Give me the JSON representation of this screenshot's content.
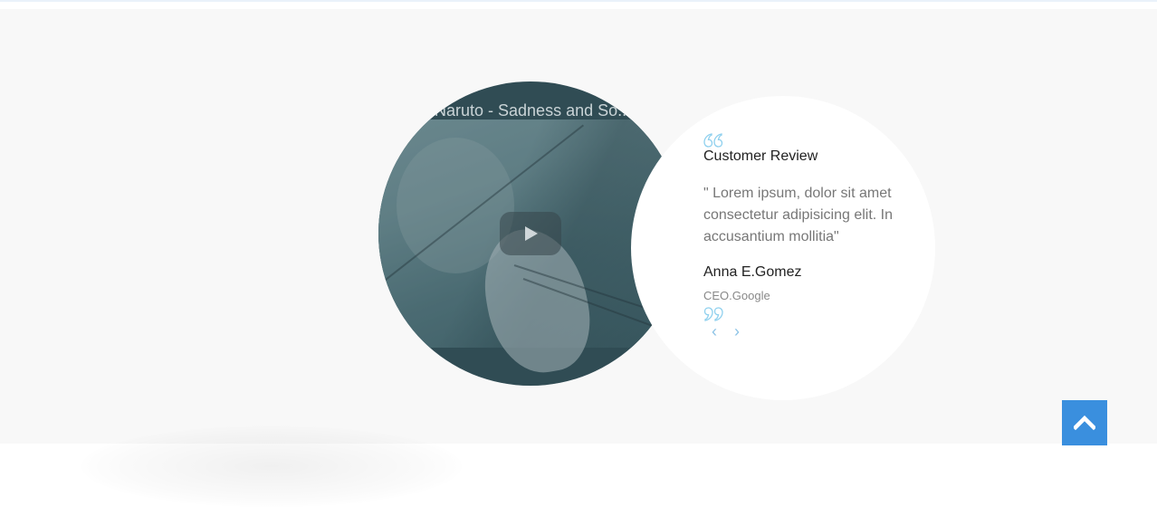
{
  "video": {
    "title": "Naruto - Sadness and So...",
    "play_icon": "play-icon"
  },
  "review": {
    "heading": "Customer Review",
    "text": "\" Lorem ipsum, dolor sit amet consectetur adipisicing elit. In accusantium mollitia\"",
    "author": "Anna E.Gomez",
    "role": "CEO.Google",
    "quote_open_icon": "quote-open-icon",
    "quote_close_icon": "quote-close-icon",
    "prev_label": "‹",
    "next_label": "›"
  },
  "scroll_top": {
    "icon": "chevron-up-icon"
  },
  "colors": {
    "accent": "#3a8fde",
    "quote": "#8fd0ee",
    "section_bg": "#f8f8f8",
    "video_tint": "#304d55"
  }
}
